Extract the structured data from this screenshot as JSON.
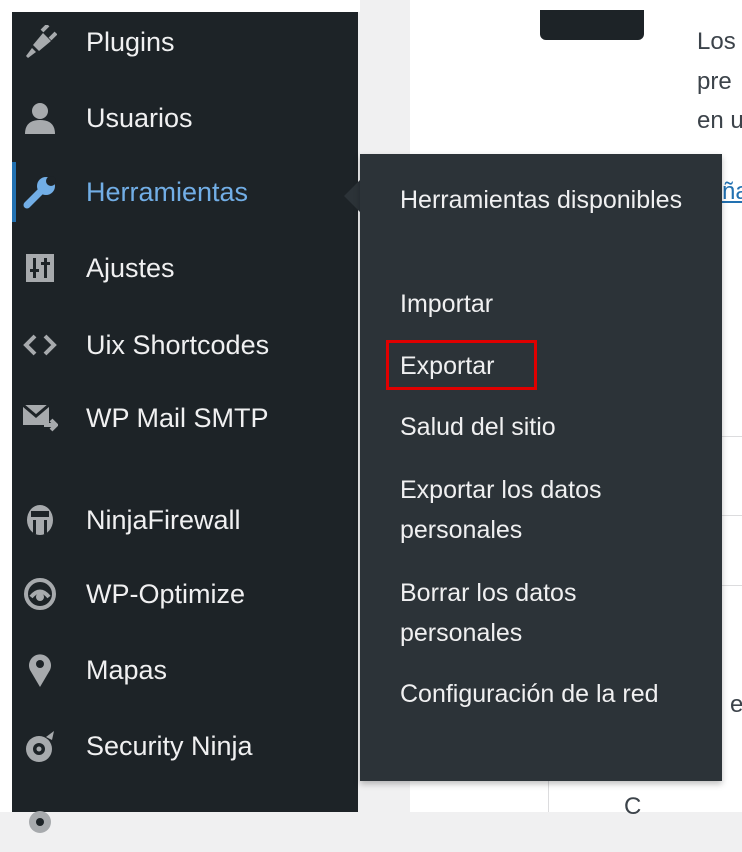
{
  "content": {
    "line1": "Los",
    "line2": "pre",
    "line3": "en u",
    "link": "ña",
    "glyph": "e",
    "bottom": "C"
  },
  "menu": [
    {
      "name": "plugins",
      "label": "Plugins",
      "icon": "plugins-icon"
    },
    {
      "name": "usuarios",
      "label": "Usuarios",
      "icon": "users-icon"
    },
    {
      "name": "herramientas",
      "label": "Herramientas",
      "icon": "wrench-icon",
      "current": true
    },
    {
      "name": "ajustes",
      "label": "Ajustes",
      "icon": "settings-sliders-icon"
    },
    {
      "name": "uix-shortcodes",
      "label": "Uix Shortcodes",
      "icon": "code-icon"
    },
    {
      "name": "wp-mail-smtp",
      "label": "WP Mail SMTP",
      "icon": "mail-send-icon"
    },
    {
      "name": "ninjafirewall",
      "label": "NinjaFirewall",
      "icon": "ninja-icon"
    },
    {
      "name": "wp-optimize",
      "label": "WP-Optimize",
      "icon": "optimize-icon"
    },
    {
      "name": "mapas",
      "label": "Mapas",
      "icon": "map-pin-icon"
    },
    {
      "name": "security-ninja",
      "label": "Security Ninja",
      "icon": "security-ninja-icon"
    }
  ],
  "submenu": [
    {
      "label": "Herramientas disponibles"
    },
    {
      "label": "Importar"
    },
    {
      "label": "Exportar",
      "highlighted": true
    },
    {
      "label": "Salud del sitio"
    },
    {
      "label": "Exportar los datos personales"
    },
    {
      "label": "Borrar los datos personales"
    },
    {
      "label": "Configuración de la red"
    }
  ],
  "colors": {
    "menu_bg": "#1d2327",
    "submenu_bg": "#2c3338",
    "current_text": "#72aee6",
    "highlight": "#e00000"
  }
}
